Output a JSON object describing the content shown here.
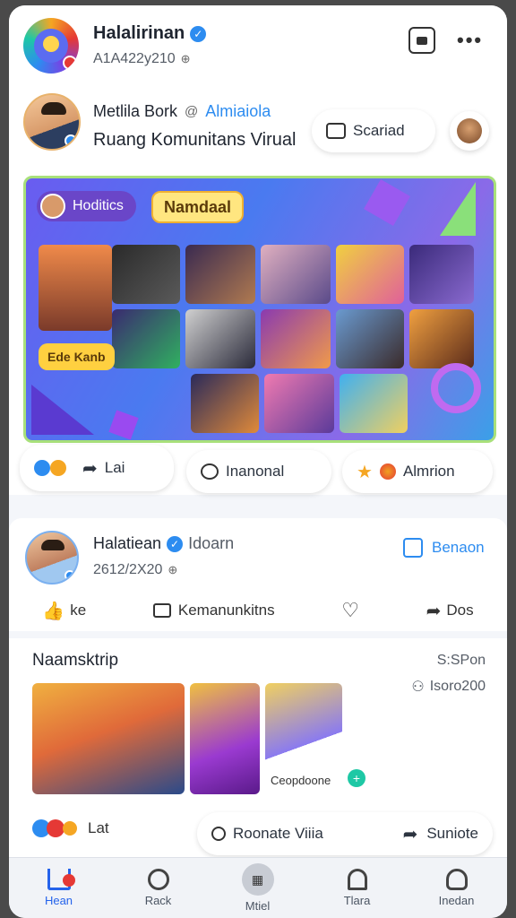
{
  "header": {
    "title": "Halalirinan",
    "subtitle": "A1A422y210"
  },
  "post1": {
    "author": "Metlila Bork",
    "handle": "Almiaiola",
    "group": "Ruang Komunitans Virual",
    "action_label": "Scariad",
    "banner_badge1": "Hoditics",
    "banner_badge2": "Namdaal",
    "banner_badge3": "Ede Kanb",
    "reaction_label": "Lai",
    "comment_label": "Inanonal",
    "award_label": "Almrion"
  },
  "post2": {
    "author": "Halatiean",
    "handle": "Idoarn",
    "date": "2612/2X20",
    "action_label": "Benaon",
    "like_label": "ke",
    "comment_label": "Kemanunkitns",
    "share_label": "Dos"
  },
  "post3": {
    "title": "Naamsktrip",
    "meta1": "S:SPon",
    "meta2": "Isoro200",
    "thumb3_label": "Ceopdoone",
    "reaction_label": "Lat",
    "comment_label": "Roonate Viiia",
    "share_label": "Suniote"
  },
  "nav": {
    "home": "Hean",
    "search": "Rack",
    "menu": "Mtiel",
    "alerts": "Tlara",
    "profile": "Inedan"
  },
  "colors": {
    "accent": "#2563eb",
    "verified": "#2d8cf0",
    "badge_red": "#e53935"
  }
}
